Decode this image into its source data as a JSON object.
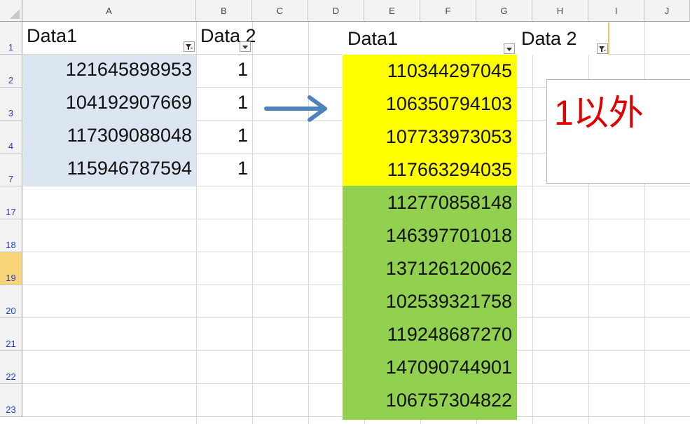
{
  "columns": [
    "A",
    "B",
    "C",
    "D",
    "E",
    "F",
    "G",
    "H",
    "I",
    "J"
  ],
  "rows": [
    "1",
    "2",
    "3",
    "4",
    "7",
    "17",
    "18",
    "19",
    "20",
    "21",
    "22",
    "23"
  ],
  "selected_row": "19",
  "left_table": {
    "header_data1": "Data1",
    "header_data2": "Data 2",
    "data1": [
      "121645898953",
      "104192907669",
      "117309088048",
      "115946787594"
    ],
    "data2": [
      "1",
      "1",
      "1",
      "1"
    ],
    "fill_color": "#dce6f1"
  },
  "right_table": {
    "header_data1": "Data1",
    "header_data2": "Data 2",
    "yellow_values": [
      "110344297045",
      "106350794103",
      "107733973053",
      "117663294035"
    ],
    "green_values": [
      "112770858148",
      "146397701018",
      "137126120062",
      "102539321758",
      "119248687270",
      "147090744901",
      "106757304822"
    ],
    "yellow_color": "#ffff00",
    "green_color": "#92d050"
  },
  "arrow_color": "#4f81bd",
  "callout": {
    "text": "1以外",
    "color": "#e00000"
  }
}
